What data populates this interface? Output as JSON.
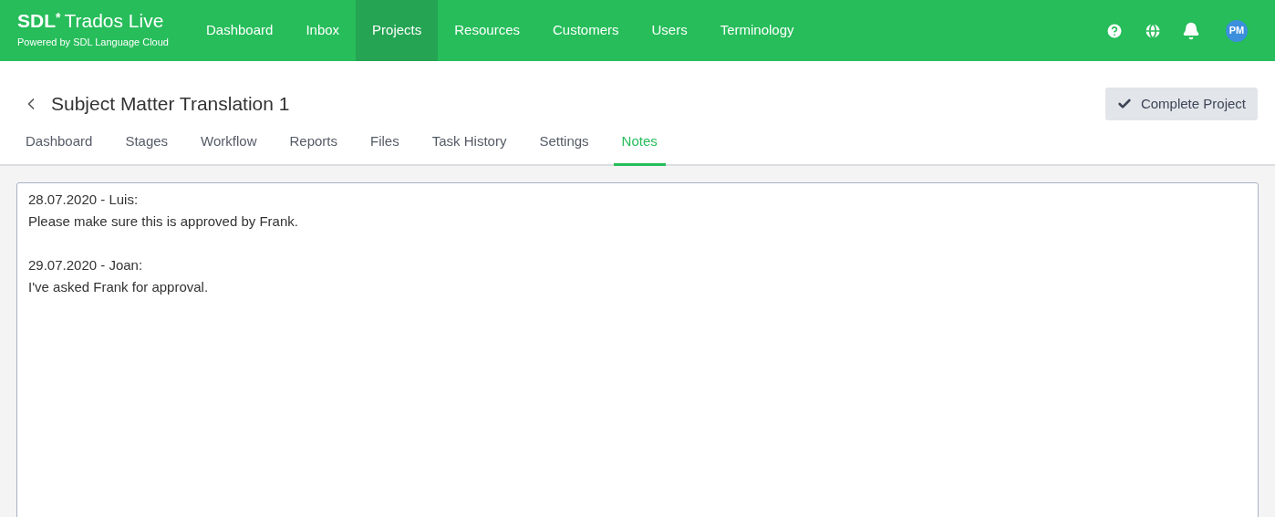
{
  "brand": {
    "mark": "SDL",
    "star": "*",
    "product": "Trados Live",
    "tagline": "Powered by SDL Language Cloud"
  },
  "nav": [
    {
      "label": "Dashboard",
      "selected": false
    },
    {
      "label": "Inbox",
      "selected": false
    },
    {
      "label": "Projects",
      "selected": true
    },
    {
      "label": "Resources",
      "selected": false
    },
    {
      "label": "Customers",
      "selected": false
    },
    {
      "label": "Users",
      "selected": false
    },
    {
      "label": "Terminology",
      "selected": false
    }
  ],
  "avatar": "PM",
  "page": {
    "title": "Subject Matter Translation 1",
    "action": "Complete Project"
  },
  "tabs": [
    {
      "label": "Dashboard",
      "selected": false
    },
    {
      "label": "Stages",
      "selected": false
    },
    {
      "label": "Workflow",
      "selected": false
    },
    {
      "label": "Reports",
      "selected": false
    },
    {
      "label": "Files",
      "selected": false
    },
    {
      "label": "Task History",
      "selected": false
    },
    {
      "label": "Settings",
      "selected": false
    },
    {
      "label": "Notes",
      "selected": true
    }
  ],
  "notes": {
    "value": "28.07.2020 - Luis:\nPlease make sure this is approved by Frank.\n\n29.07.2020 - Joan:\nI've asked Frank for approval."
  }
}
